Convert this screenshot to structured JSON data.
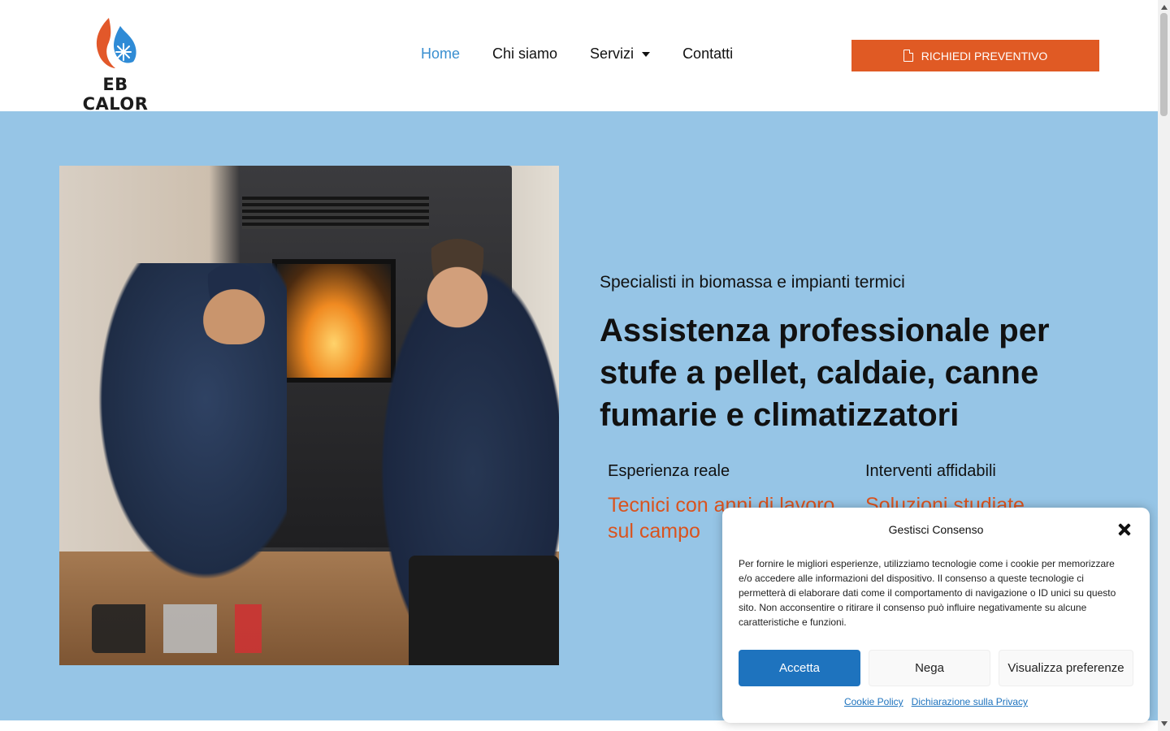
{
  "brand": {
    "logo_text": "EB CALOR",
    "accent": "#e05a24",
    "link_blue": "#3a8fd0",
    "hero_bg": "#96c5e6"
  },
  "nav": {
    "items": [
      {
        "label": "Home",
        "active": true
      },
      {
        "label": "Chi siamo"
      },
      {
        "label": "Servizi",
        "has_dropdown": true
      },
      {
        "label": "Contatti"
      }
    ],
    "cta_label": "RICHIEDI PREVENTIVO",
    "cta_icon": "document-icon"
  },
  "hero": {
    "kicker": "Specialisti in biomassa e impianti termici",
    "headline": "Assistenza professionale per stufe a pellet, caldaie, canne fumarie e climatizzatori",
    "features": [
      {
        "title": "Esperienza reale",
        "text": "Tecnici con anni di lavoro sul campo"
      },
      {
        "title": "Interventi affidabili",
        "text": "Soluzioni studiate"
      }
    ]
  },
  "cookie": {
    "title": "Gestisci Consenso",
    "text": "Per fornire le migliori esperienze, utilizziamo tecnologie come i cookie per memorizzare e/o accedere alle informazioni del dispositivo. Il consenso a queste tecnologie ci permetterà di elaborare dati come il comportamento di navigazione o ID unici su questo sito. Non acconsentire o ritirare il consenso può influire negativamente su alcune caratteristiche e funzioni.",
    "accept": "Accetta",
    "deny": "Nega",
    "preferences": "Visualizza preferenze",
    "links": [
      "Cookie Policy",
      "Dichiarazione sulla Privacy"
    ]
  }
}
